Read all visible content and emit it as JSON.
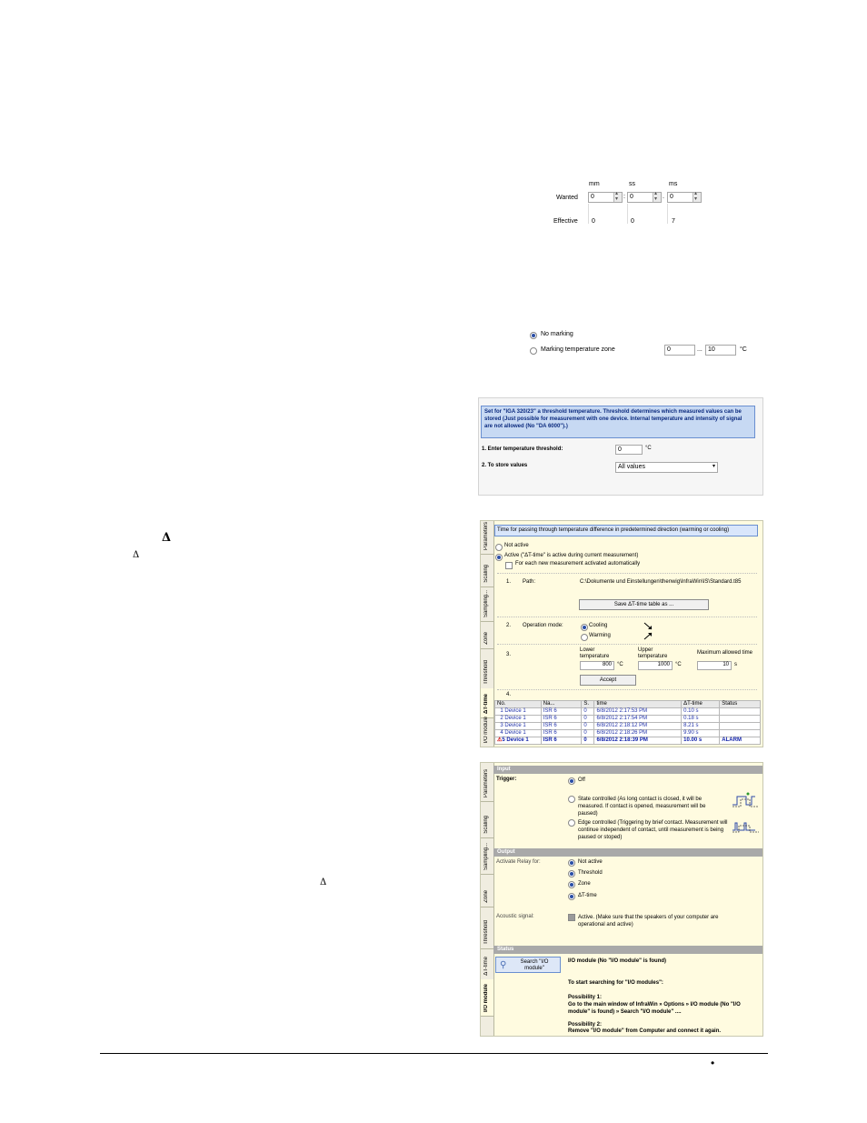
{
  "time_setting": {
    "headers": [
      "mm",
      "ss",
      "ms"
    ],
    "wanted_label": "Wanted",
    "effective_label": "Effective",
    "wanted_values": [
      "0",
      "0",
      "0"
    ],
    "separators": [
      ":",
      "."
    ],
    "effective_values": [
      "0",
      "0",
      "7"
    ]
  },
  "marking": {
    "no_marking": "No marking",
    "marking_zone": "Marking temperature zone",
    "zone_from": "0",
    "zone_dots": "...",
    "zone_to": "10",
    "unit": "°C"
  },
  "threshold_box": {
    "info": "Set for \"IGA 320/23\" a threshold temperature. Threshold determines which measured values can be stored (Just possible for measurement with one device. Internal temperature and intensity of signal are not allowed (No \"DA 6000\").)",
    "step1_label": "1. Enter temperature threshold:",
    "step1_value": "0",
    "step1_unit": "°C",
    "step2_label": "2. To store values",
    "step2_value": "All values"
  },
  "delta_symbols": {
    "large": "Δ",
    "small": "Δ",
    "lower": "Δ"
  },
  "dt_panel": {
    "tabs": [
      "Parameters",
      "Scaling",
      "Sampling...",
      "Zone",
      "Threshold",
      "ΔT-time",
      "I/O module"
    ],
    "header": "Time for passing through temperature difference in predetermined direction (warming or cooling)",
    "not_active": "Not active",
    "active": "Active (\"ΔT-time\" is active during current measurement)",
    "auto": "For each new measurement activated automatically",
    "step1": "1.",
    "path_label": "Path:",
    "path_value": "C:\\Dokumente und Einstellungen\\thenwig\\InfraWin\\IS\\Standard.t85",
    "save_button": "Save ΔT-time table as ...",
    "step2": "2.",
    "operation_label": "Operation mode:",
    "cooling": "Cooling",
    "warming": "Warming",
    "step3": "3.",
    "lower_label": "Lower temperature",
    "lower_value": "800",
    "upper_label": "Upper temperature",
    "upper_value": "1000",
    "max_label": "Maximum allowed time",
    "max_value": "10",
    "unit_c": "°C",
    "unit_s": "s",
    "accept": "Accept",
    "step4": "4.",
    "table_headers": [
      "No.",
      "Na...",
      "S.",
      "time",
      "ΔT-time",
      "Status"
    ],
    "rows": [
      [
        "1",
        "Device 1",
        "ISR 6",
        "0",
        "6/8/2012 2:17:53 PM",
        "0.10 s",
        ""
      ],
      [
        "2",
        "Device 1",
        "ISR 6",
        "0",
        "6/8/2012 2:17:54 PM",
        "0.18 s",
        ""
      ],
      [
        "3",
        "Device 1",
        "ISR 6",
        "0",
        "6/8/2012 2:18:12 PM",
        "8.21 s",
        ""
      ],
      [
        "4",
        "Device 1",
        "ISR 6",
        "0",
        "6/8/2012 2:18:26 PM",
        "9.90 s",
        ""
      ]
    ],
    "alarm_row": [
      "5",
      "Device 1",
      "ISR 6",
      "0",
      "6/8/2012 2:18:39 PM",
      "10.00 s",
      "ALARM"
    ]
  },
  "io_panel": {
    "tabs": [
      "Parameters",
      "Scaling",
      "Sampling...",
      "Zone",
      "Threshold",
      "ΔT-time",
      "I/O module"
    ],
    "input_header": "Input",
    "trigger_label": "Trigger:",
    "trigger_off": "Off",
    "state_controlled": "State controlled (As long contact is closed, it will be measured. If contact is opened, measurement will be paused)",
    "edge_controlled": "Edge controlled (Triggering by brief contact. Measurement will continue independent of contact, until measurement is being paused or stoped)",
    "output_header": "Output",
    "relay_label": "Activate Relay for:",
    "relay_options": [
      "Not active",
      "Threshold",
      "Zone",
      "ΔT-time"
    ],
    "acoustic_label": "Acoustic signal:",
    "acoustic_text": "Active. (Make sure that the speakers of your computer are operational and active)",
    "status_header": "Status",
    "search_button": "Search \"I/O module\"",
    "status_text": "I/O module (No \"I/O module\" is found)",
    "start_text": "To start searching for \"I/O modules\":",
    "poss1_title": "Possibility 1:",
    "poss1_text": "Go to the main window of InfraWin » Options » I/O module (No \"I/O module\" is found) » Search \"I/O module\" ....",
    "poss2_title": "Possibility 2:",
    "poss2_text": "Remove \"I/O module\" from Computer and connect it again."
  },
  "footer": {
    "bullet": "•"
  }
}
